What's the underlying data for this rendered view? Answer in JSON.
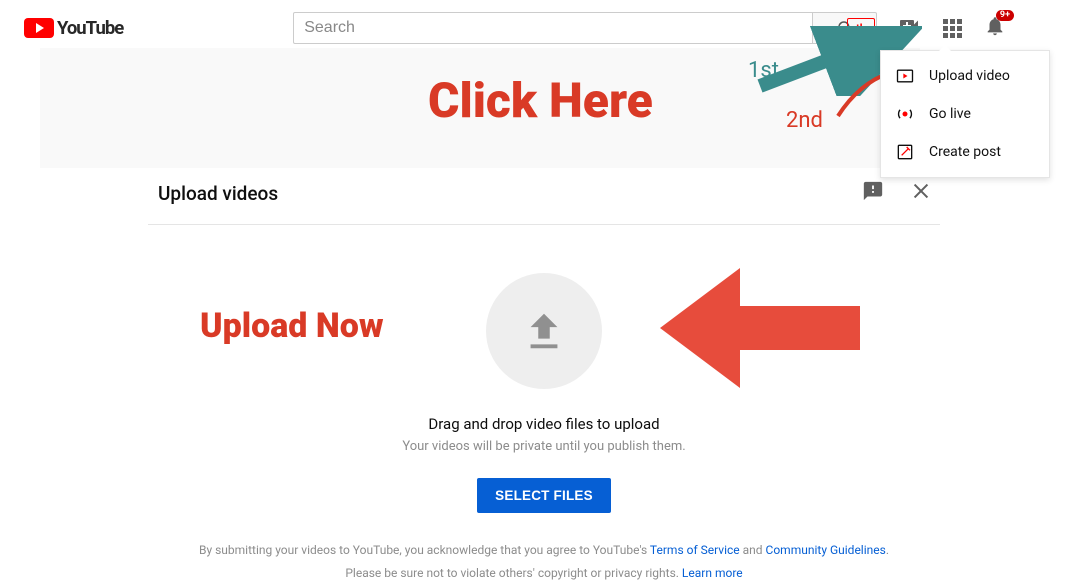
{
  "header": {
    "logo_text": "YouTube",
    "search_placeholder": "Search",
    "notification_count": "9+"
  },
  "create_menu": {
    "items": [
      {
        "label": "Upload video"
      },
      {
        "label": "Go live"
      },
      {
        "label": "Create post"
      }
    ]
  },
  "annotations": {
    "click_here": "Click Here",
    "first": "1st",
    "second": "2nd",
    "upload_now": "Upload Now"
  },
  "upload_modal": {
    "title": "Upload videos",
    "drag_line": "Drag and drop video files to upload",
    "privacy_line": "Your videos will be private until you publish them.",
    "select_button": "SELECT FILES",
    "legal_prefix": "By submitting your videos to YouTube, you acknowledge that you agree to YouTube's ",
    "tos": "Terms of Service",
    "legal_and": " and ",
    "guidelines": "Community Guidelines",
    "legal_period": ".",
    "legal_line2_prefix": "Please be sure not to violate others' copyright or privacy rights. ",
    "learn_more": "Learn more"
  }
}
